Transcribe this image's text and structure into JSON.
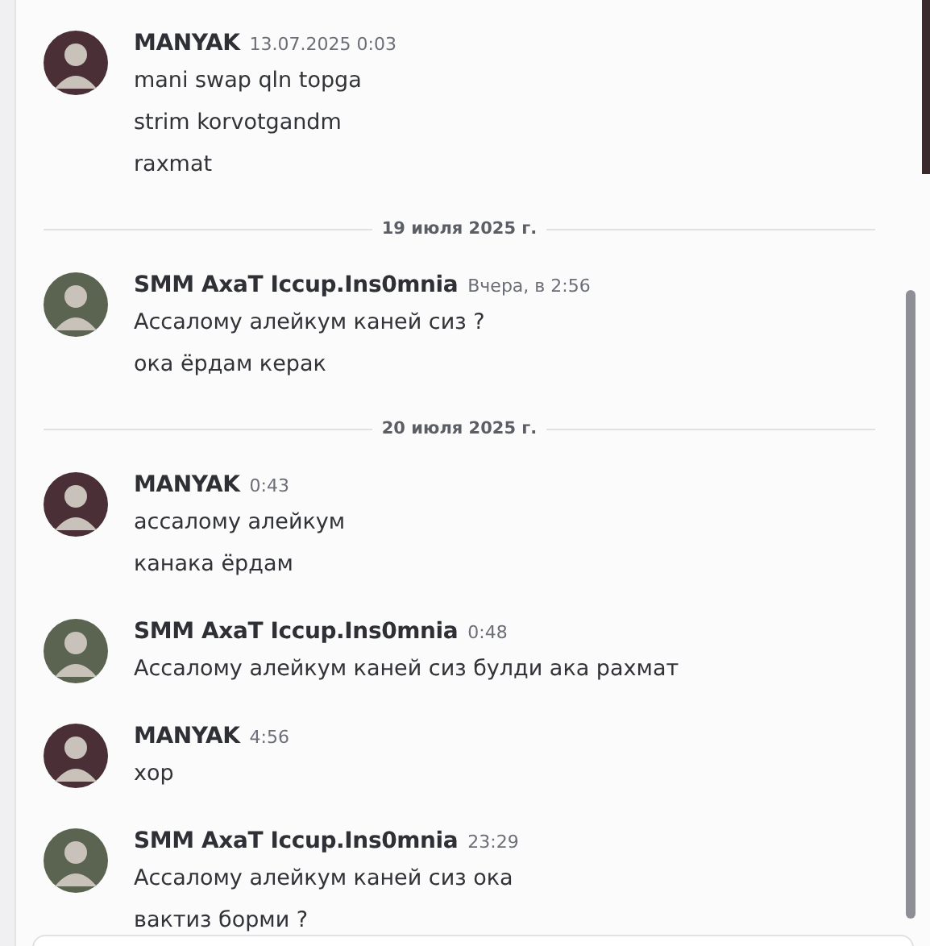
{
  "feed": [
    {
      "kind": "group",
      "author": "MANYAK",
      "time": "13.07.2025 0:03",
      "color": "#4a3036",
      "lines": [
        "mani swap qln topga",
        "strim korvotgandm",
        "raxmat"
      ]
    },
    {
      "kind": "divider",
      "label": "19 июля 2025 г."
    },
    {
      "kind": "group",
      "author": "SMM AxaT Iccup.Ins0mnia",
      "time": "Вчера, в 2:56",
      "color": "#5b6450",
      "lines": [
        "Ассалому алейкум каней сиз ?",
        "ока ёрдам керак"
      ]
    },
    {
      "kind": "divider",
      "label": "20 июля 2025 г."
    },
    {
      "kind": "group",
      "author": "MANYAK",
      "time": "0:43",
      "color": "#4a3036",
      "lines": [
        "ассалому алейкум",
        "канака ёрдам"
      ]
    },
    {
      "kind": "group",
      "author": "SMM AxaT Iccup.Ins0mnia",
      "time": "0:48",
      "color": "#5b6450",
      "lines": [
        "Ассалому алейкум каней сиз булди ака рахмат"
      ]
    },
    {
      "kind": "group",
      "author": "MANYAK",
      "time": "4:56",
      "color": "#4a3036",
      "lines": [
        "хор"
      ]
    },
    {
      "kind": "group",
      "author": "SMM AxaT Iccup.Ins0mnia",
      "time": "23:29",
      "color": "#5b6450",
      "lines": [
        "Ассалому алейкум каней сиз ока",
        "вактиз борми ?"
      ]
    }
  ]
}
